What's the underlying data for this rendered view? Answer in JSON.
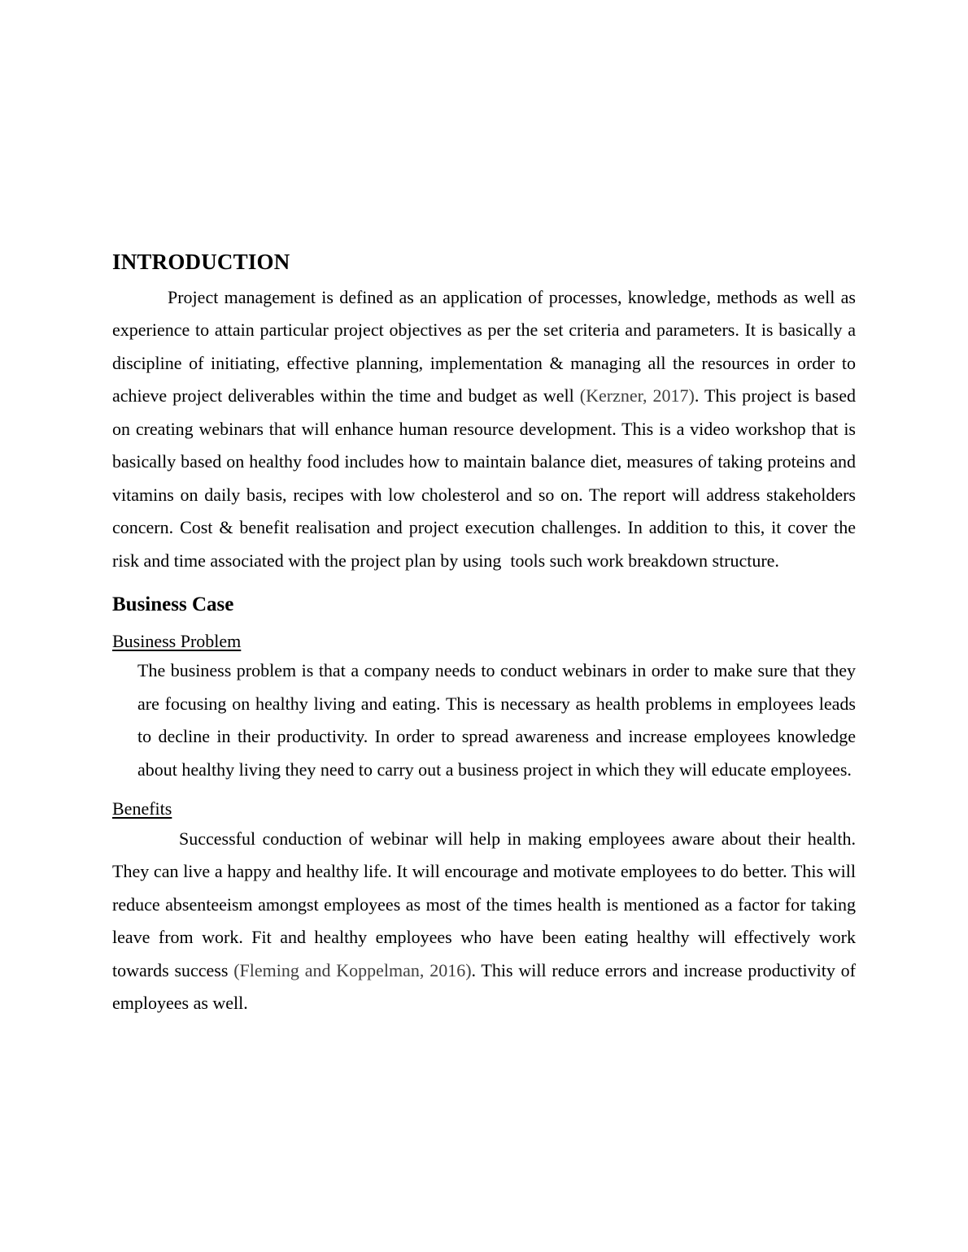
{
  "document": {
    "heading": "INTRODUCTION",
    "intro_paragraph": {
      "text_before_cite": "Project management is defined as an application of processes, knowledge, methods as well as experience to attain particular project objectives as per the set criteria and parameters. It is basically a discipline of initiating, effective planning, implementation & managing all the resources in order to achieve project deliverables within the time and budget as well ",
      "citation": "(Kerzner, 2017)",
      "text_after_cite": ". This project is based  on creating webinars that will enhance human resource development. This is a video workshop that is basically based on healthy food includes how to maintain balance diet, measures of taking proteins and vitamins on daily basis, recipes with low cholesterol and so on. The report will address stakeholders concern. Cost & benefit realisation and project execution challenges. In addition to this, it cover the risk and time associated with the project plan by using  tools such work breakdown structure."
    },
    "business_case": {
      "heading": "Business Case",
      "business_problem": {
        "heading": "Business Problem",
        "paragraph": "The business problem is that a company needs to conduct webinars in order to make sure that they are focusing on healthy living and eating. This is necessary as health problems in employees leads to decline in their productivity. In order to spread awareness and increase employees knowledge about healthy living they need to carry out a business project in which they will educate employees."
      },
      "benefits": {
        "heading": "Benefits",
        "text_before_cite": "Successful conduction of webinar will help in making employees aware about their health. They can live a happy and healthy life. It will encourage and motivate employees to do better. This will reduce absenteeism amongst employees as most of the times health is mentioned as a factor for taking leave from work. Fit and healthy employees who have been eating healthy will effectively work towards success ",
        "citation": "(Fleming and Koppelman, 2016)",
        "text_after_cite": ". This will reduce errors and increase productivity of employees as well."
      }
    }
  }
}
